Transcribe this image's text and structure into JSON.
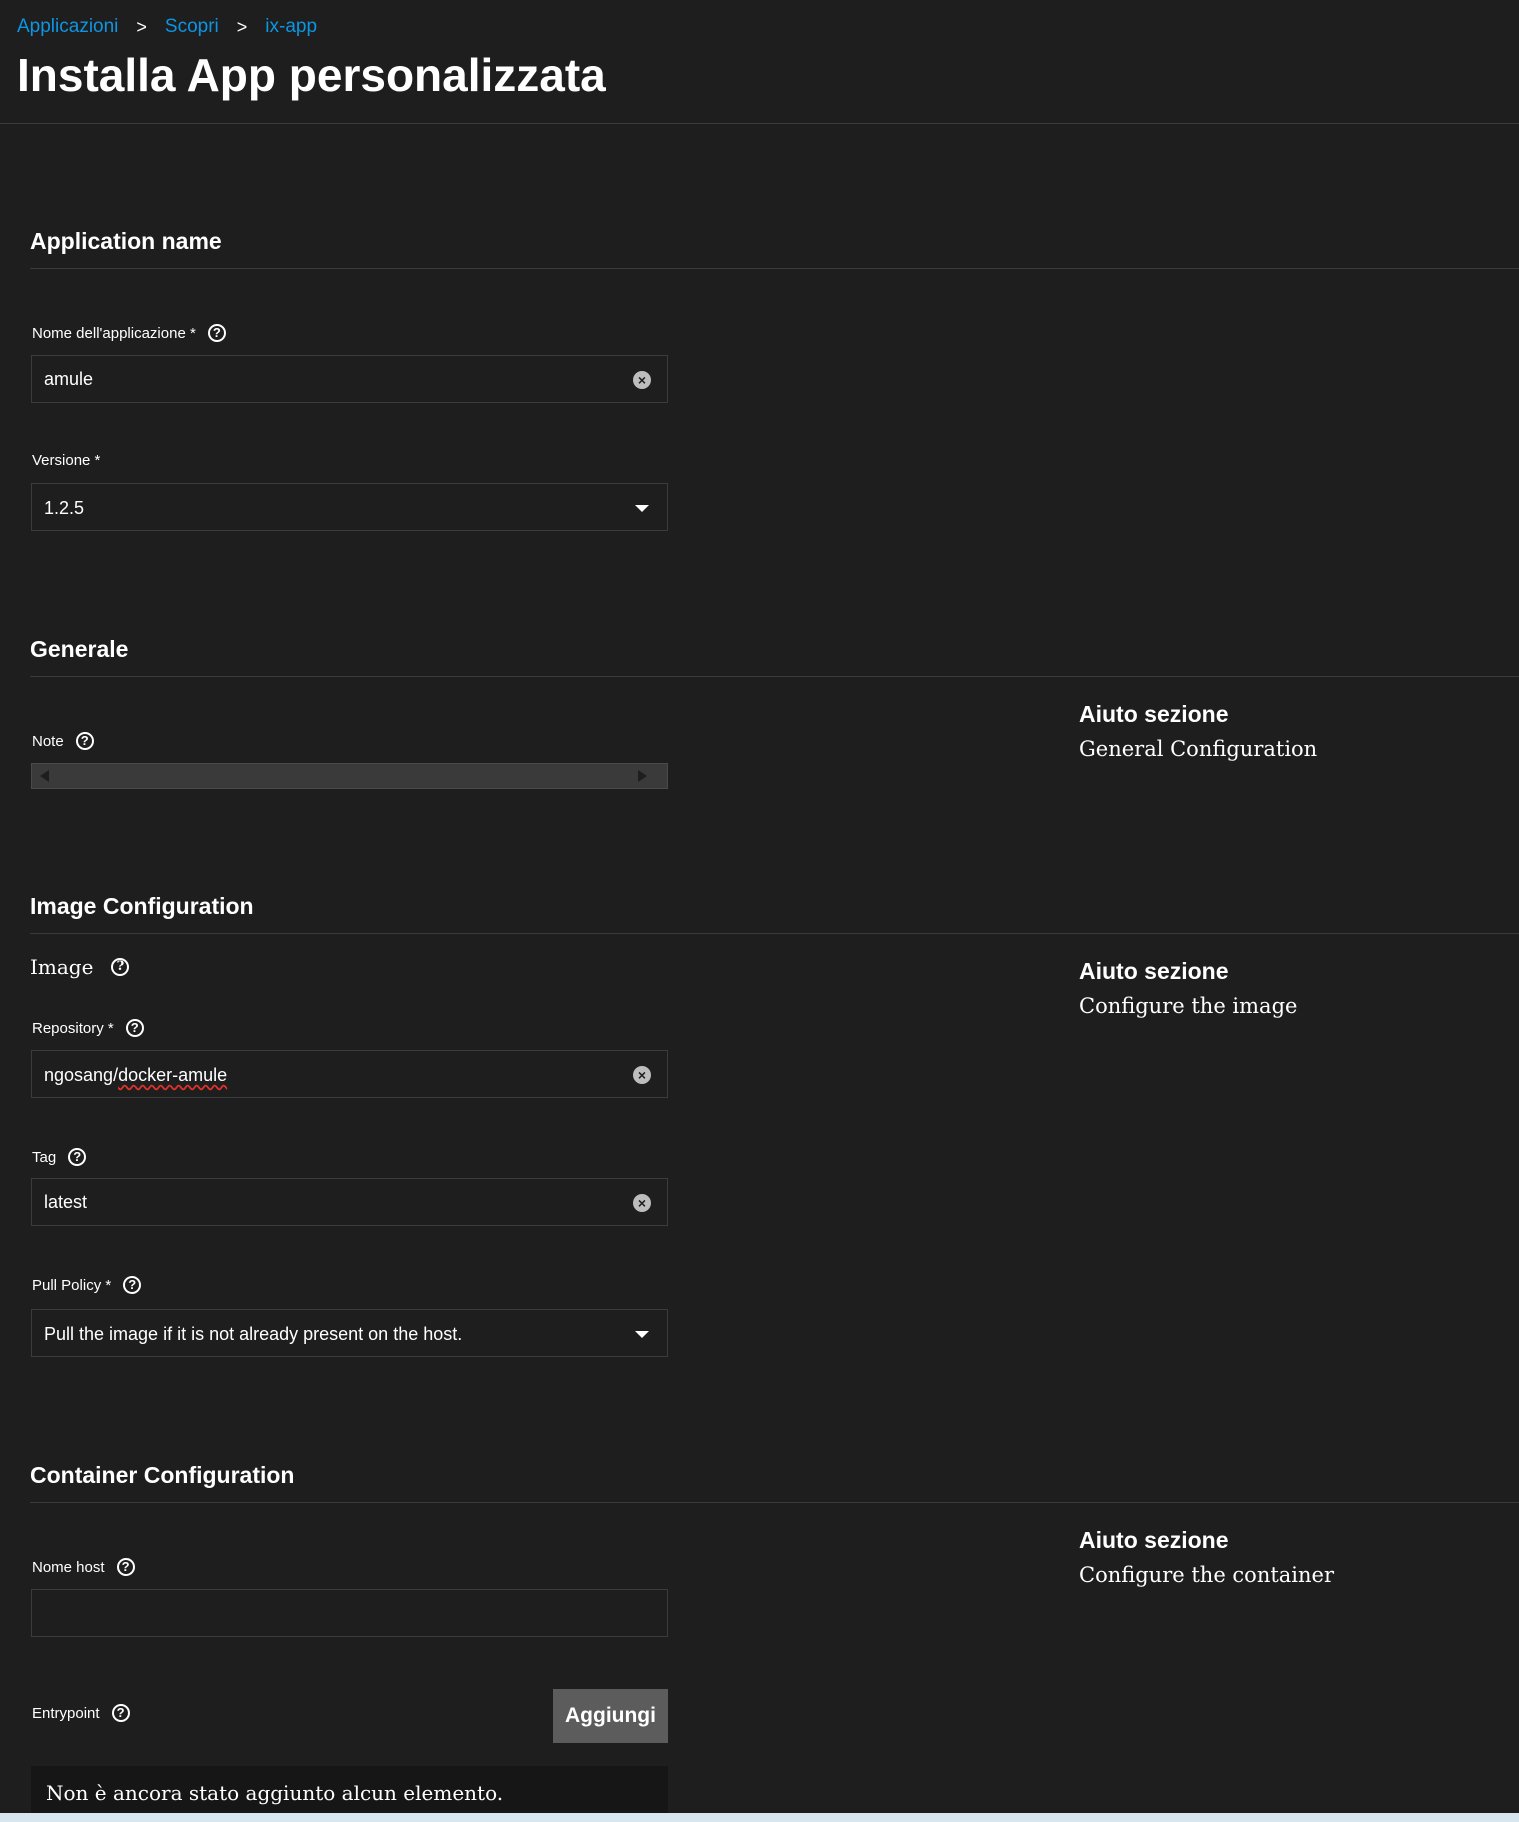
{
  "breadcrumb": {
    "items": [
      "Applicazioni",
      "Scopri",
      "ix-app"
    ],
    "separator": ">"
  },
  "page": {
    "title": "Installa App personalizzata"
  },
  "sections": {
    "application_name": {
      "title": "Application name",
      "app_name_label": "Nome dell'applicazione *",
      "app_name_value": "amule",
      "version_label": "Versione *",
      "version_value": "1.2.5"
    },
    "general": {
      "title": "Generale",
      "note_label": "Note",
      "help_title": "Aiuto sezione",
      "help_text": "General Configuration"
    },
    "image_configuration": {
      "title": "Image Configuration",
      "image_label": "Image",
      "help_title": "Aiuto sezione",
      "help_text": "Configure the image",
      "repository_label": "Repository *",
      "repository_value_prefix": "ngosang/",
      "repository_value_suffix": "docker-amule",
      "tag_label": "Tag",
      "tag_value": "latest",
      "pull_policy_label": "Pull Policy *",
      "pull_policy_value": "Pull the image if it is not already present on the host."
    },
    "container_configuration": {
      "title": "Container Configuration",
      "help_title": "Aiuto sezione",
      "help_text": "Configure the container",
      "hostname_label": "Nome host",
      "hostname_value": "",
      "entrypoint_label": "Entrypoint",
      "add_button_label": "Aggiungi",
      "empty_list_text": "Non è ancora stato aggiunto alcun elemento."
    }
  },
  "icons": {
    "help": "help-circle-icon",
    "clear": "clear-circle-icon",
    "dropdown": "caret-down-icon"
  },
  "colors": {
    "background": "#1e1e1e",
    "link": "#0d95e3",
    "divider": "#3a3a3a",
    "button": "#5c5c5c"
  }
}
